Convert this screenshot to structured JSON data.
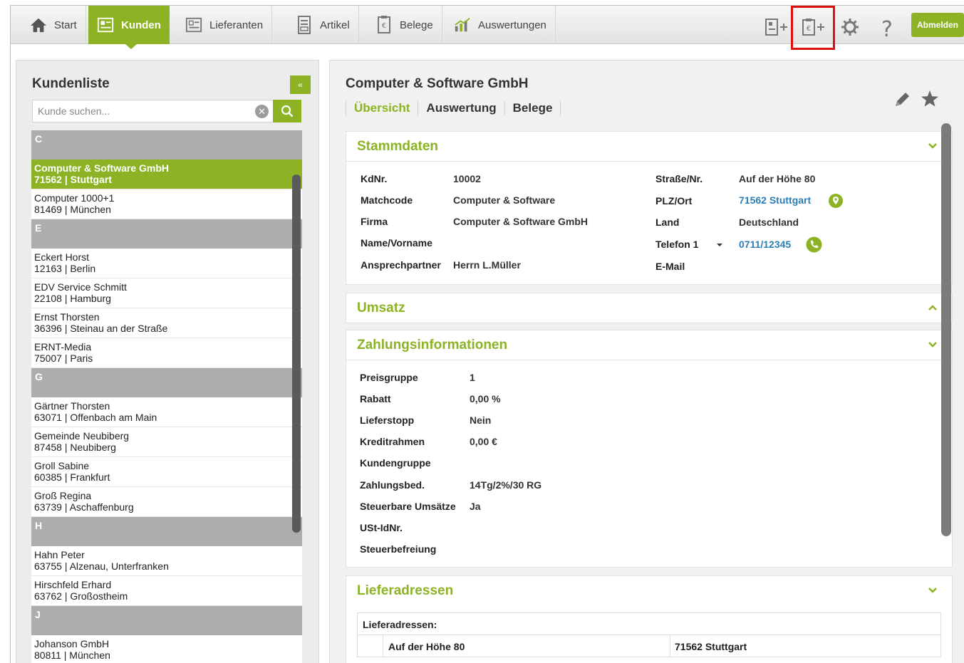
{
  "nav": {
    "items": [
      {
        "label": "Start",
        "icon": "home-icon"
      },
      {
        "label": "Kunden",
        "icon": "customers-icon",
        "active": true
      },
      {
        "label": "Lieferanten",
        "icon": "suppliers-icon"
      },
      {
        "label": "Artikel",
        "icon": "article-icon"
      },
      {
        "label": "Belege",
        "icon": "document-icon"
      },
      {
        "label": "Auswertungen",
        "icon": "chart-icon"
      }
    ],
    "tools": [
      "add-customer-icon",
      "add-document-icon",
      "gear-icon",
      "help-icon"
    ],
    "logout_label": "Abmelden",
    "accent_color": "#8db325",
    "highlight_color": "#e01010"
  },
  "left": {
    "title": "Kundenliste",
    "collapse_label": "«",
    "search_placeholder": "Kunde suchen...",
    "groups": [
      {
        "letter": "C",
        "customers": [
          {
            "name": "Computer & Software GmbH",
            "line2": "71562 | Stuttgart",
            "selected": true
          },
          {
            "name": "Computer 1000+1",
            "line2": "81469 | München"
          }
        ]
      },
      {
        "letter": "E",
        "customers": [
          {
            "name": "Eckert Horst",
            "line2": "12163 | Berlin"
          },
          {
            "name": "EDV Service Schmitt",
            "line2": "22108 | Hamburg"
          },
          {
            "name": "Ernst Thorsten",
            "line2": "36396 | Steinau an der Straße"
          },
          {
            "name": "ERNT-Media",
            "line2": "75007 | Paris"
          }
        ]
      },
      {
        "letter": "G",
        "customers": [
          {
            "name": "Gärtner Thorsten",
            "line2": "63071 | Offenbach am Main"
          },
          {
            "name": "Gemeinde Neubiberg",
            "line2": "87458 | Neubiberg"
          },
          {
            "name": "Groll Sabine",
            "line2": "60385 | Frankfurt"
          },
          {
            "name": "Groß Regina",
            "line2": "63739 | Aschaffenburg"
          }
        ]
      },
      {
        "letter": "H",
        "customers": [
          {
            "name": "Hahn Peter",
            "line2": "63755 | Alzenau, Unterfranken"
          },
          {
            "name": "Hirschfeld Erhard",
            "line2": "63762 | Großostheim"
          }
        ]
      },
      {
        "letter": "J",
        "customers": [
          {
            "name": "Johanson GmbH",
            "line2": "80811 | München"
          }
        ]
      }
    ]
  },
  "detail": {
    "title": "Computer & Software GmbH",
    "tabs": [
      "Übersicht",
      "Auswertung",
      "Belege"
    ],
    "stammdaten": {
      "header": "Stammdaten",
      "kdnr_label": "KdNr.",
      "kdnr": "10002",
      "matchcode_label": "Matchcode",
      "matchcode": "Computer & Software",
      "firma_label": "Firma",
      "firma": "Computer & Software GmbH",
      "name_label": "Name/Vorname",
      "ansprech_label": "Ansprechpartner",
      "ansprech": "Herrn L.Müller",
      "strasse_label": "Straße/Nr.",
      "strasse": "Auf der Höhe 80",
      "plz_label": "PLZ/Ort",
      "plz": "71562 Stuttgart",
      "land_label": "Land",
      "land": "Deutschland",
      "telefon_label": "Telefon 1",
      "telefon": "0711/12345",
      "email_label": "E-Mail"
    },
    "umsatz": {
      "header": "Umsatz"
    },
    "zahlung": {
      "header": "Zahlungsinformationen",
      "rows": [
        {
          "label": "Preisgruppe",
          "value": "1"
        },
        {
          "label": "Rabatt",
          "value": "0,00 %"
        },
        {
          "label": "Lieferstopp",
          "value": "Nein"
        },
        {
          "label": "Kreditrahmen",
          "value": "0,00 €"
        },
        {
          "label": "Kundengruppe",
          "value": ""
        },
        {
          "label": "Zahlungsbed.",
          "value": "14Tg/2%/30 RG"
        },
        {
          "label": "Steuerbare Umsätze",
          "value": "Ja"
        },
        {
          "label": "USt-IdNr.",
          "value": ""
        },
        {
          "label": "Steuerbefreiung",
          "value": ""
        }
      ]
    },
    "liefer": {
      "header": "Lieferadressen",
      "inner_label": "Lieferadressen:",
      "street": "Auf der Höhe 80",
      "city": "71562 Stuttgart"
    }
  }
}
